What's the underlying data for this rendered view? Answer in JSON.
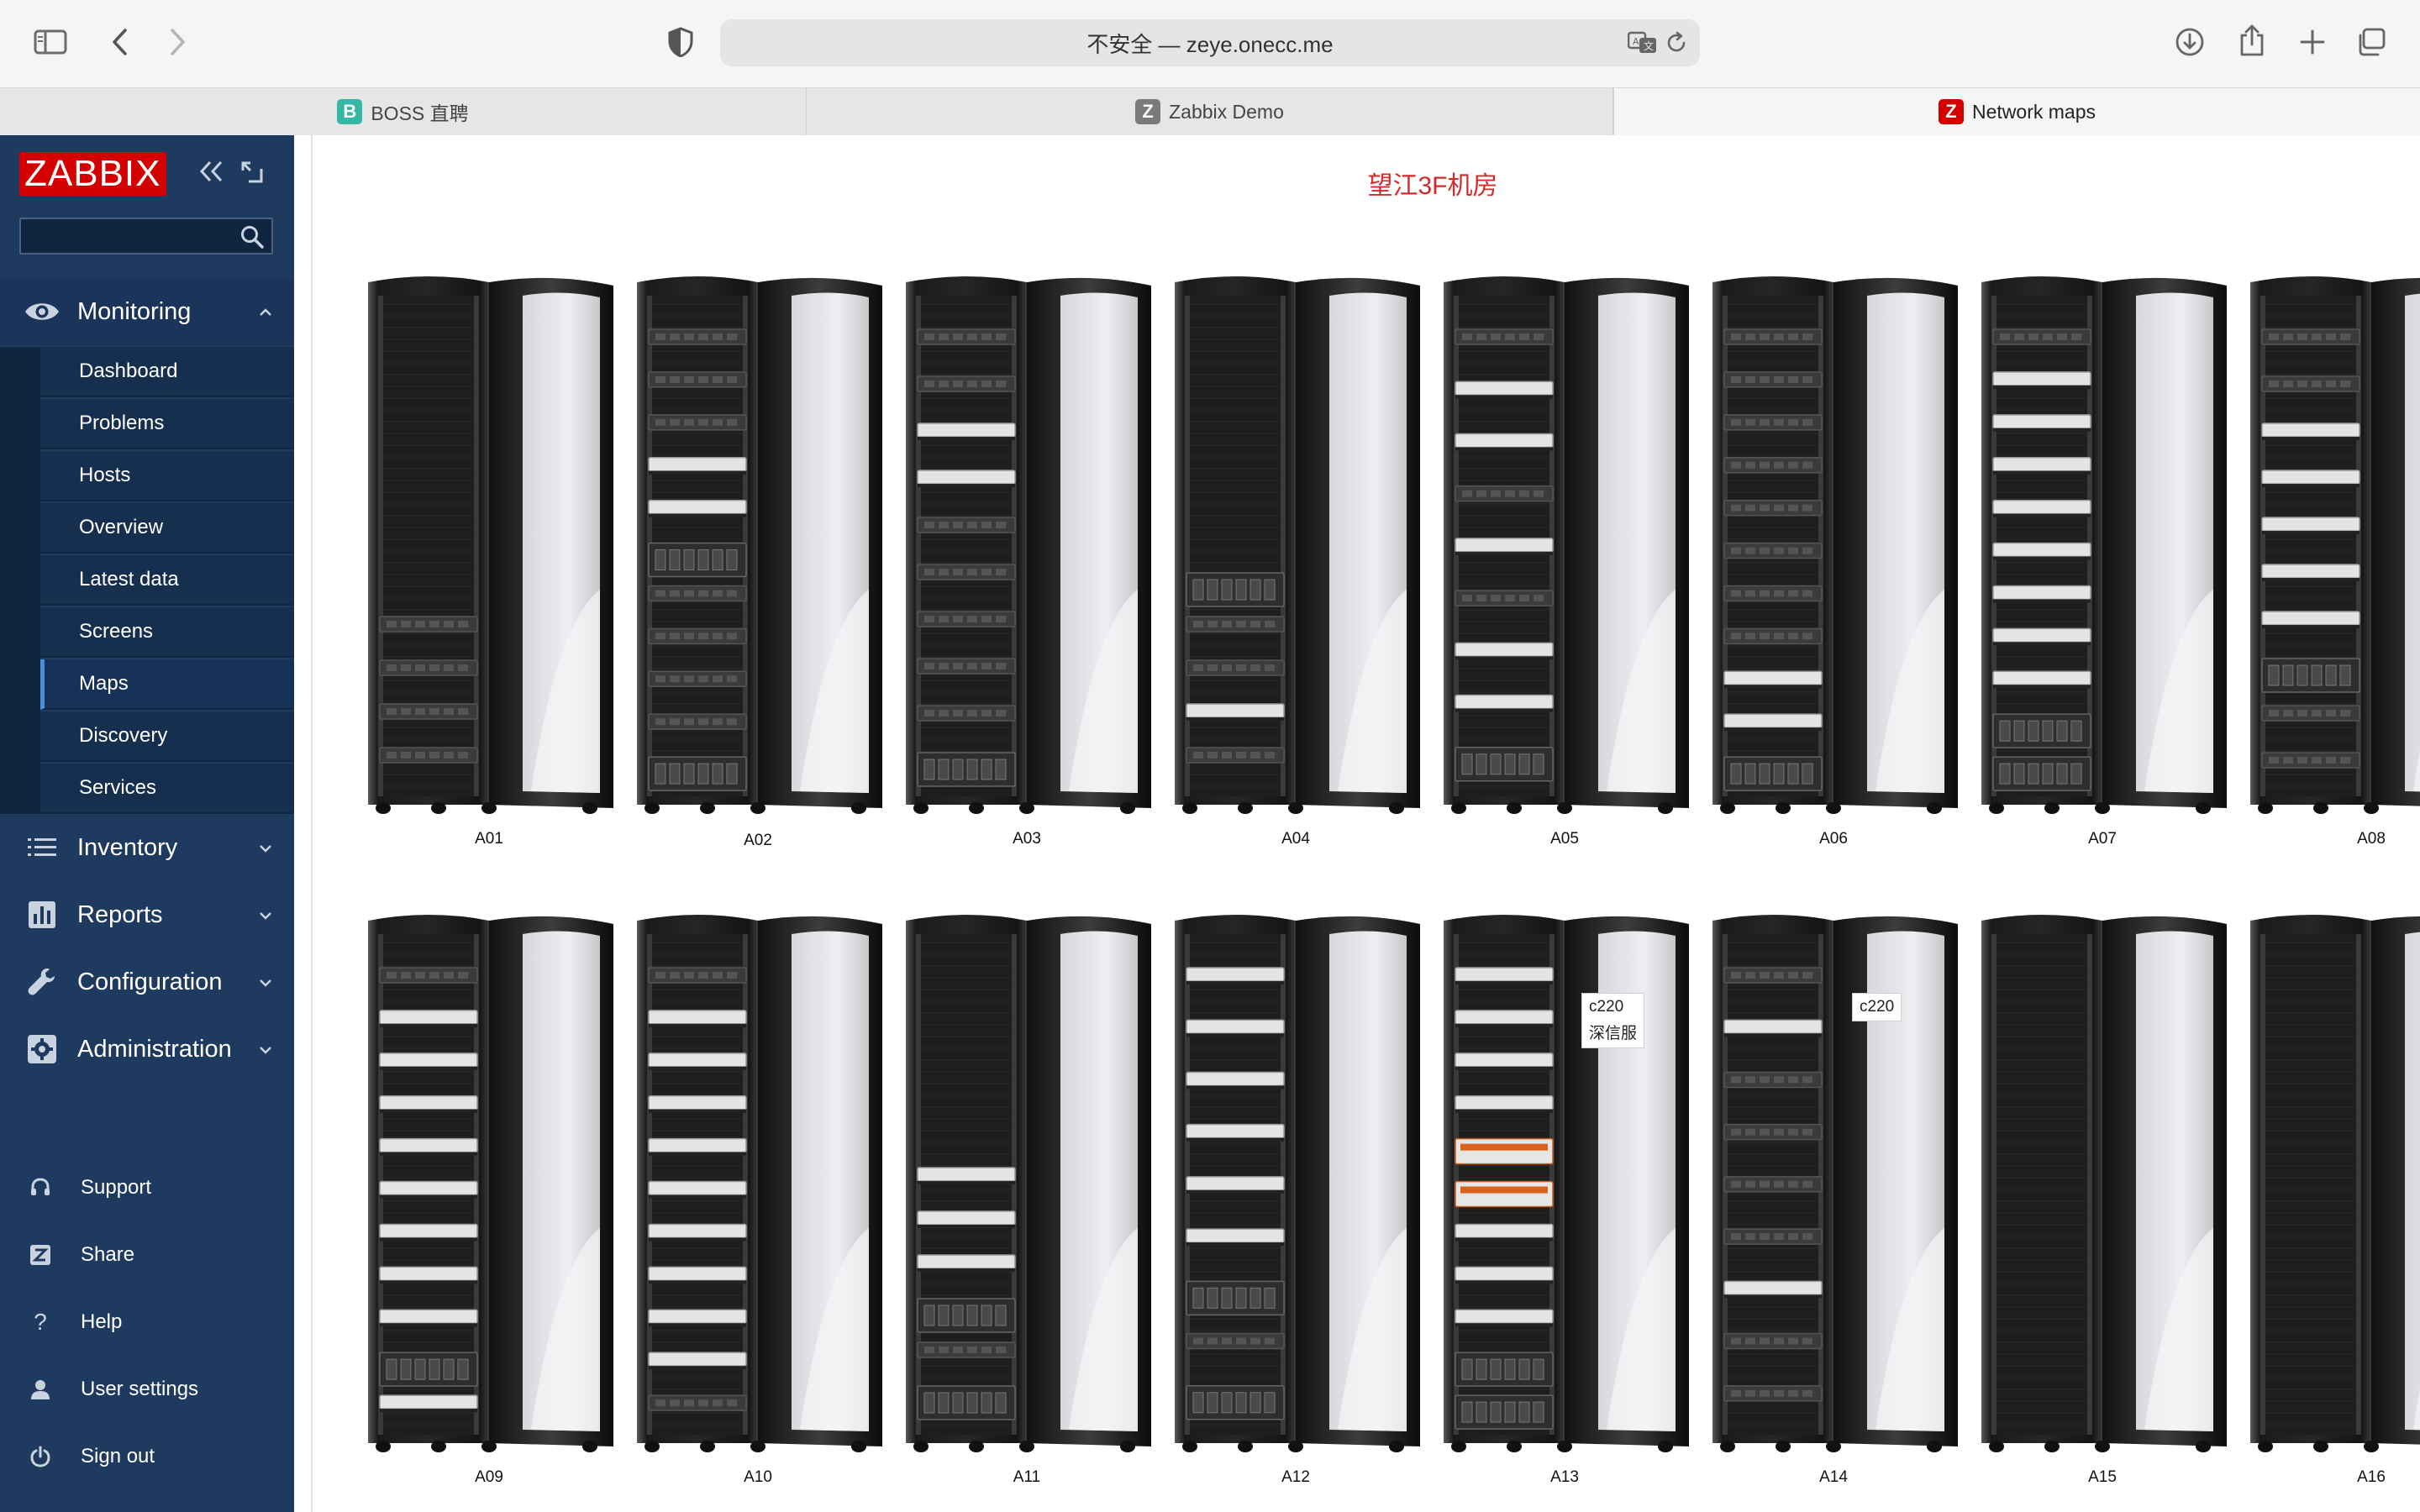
{
  "browser": {
    "address_text": "不安全 — zeye.onecc.me",
    "tabs": [
      {
        "label": "BOSS 直聘",
        "favicon_letter": "B",
        "favicon_color": "#35b8a6"
      },
      {
        "label": "Zabbix Demo",
        "favicon_letter": "Z",
        "favicon_color": "#7a7a7a"
      },
      {
        "label": "Network maps",
        "favicon_letter": "Z",
        "favicon_color": "#d40000"
      }
    ],
    "icons": [
      "sidebar-icon",
      "back-icon",
      "forward-icon",
      "shield-icon",
      "translate-icon",
      "reload-icon",
      "download-icon",
      "share-icon",
      "new-tab-icon",
      "tab-overview-icon"
    ]
  },
  "sidebar": {
    "logo": "ZABBIX",
    "search_placeholder": "",
    "sections": [
      {
        "label": "Monitoring",
        "icon": "eye-icon",
        "expanded": true
      },
      {
        "label": "Inventory",
        "icon": "list-icon",
        "expanded": false
      },
      {
        "label": "Reports",
        "icon": "chart-icon",
        "expanded": false
      },
      {
        "label": "Configuration",
        "icon": "wrench-icon",
        "expanded": false
      },
      {
        "label": "Administration",
        "icon": "gear-icon",
        "expanded": false
      }
    ],
    "monitoring_items": [
      "Dashboard",
      "Problems",
      "Hosts",
      "Overview",
      "Latest data",
      "Screens",
      "Maps",
      "Discovery",
      "Services"
    ],
    "selected_item": "Maps",
    "bottom_items": [
      {
        "label": "Support",
        "icon": "headset-icon"
      },
      {
        "label": "Share",
        "icon": "share-z-icon"
      },
      {
        "label": "Help",
        "icon": "question-icon"
      },
      {
        "label": "User settings",
        "icon": "user-icon"
      },
      {
        "label": "Sign out",
        "icon": "power-icon"
      }
    ]
  },
  "map": {
    "title": "望江3F机房",
    "title_color": "#d42a2a",
    "racks": [
      {
        "label": "A01",
        "servers": [
          "d",
          "d",
          "d",
          "d"
        ]
      },
      {
        "label": "A02",
        "servers": [
          "d",
          "d",
          "d",
          "w",
          "w",
          "b",
          "d",
          "d",
          "d",
          "d",
          "b"
        ]
      },
      {
        "label": "A03",
        "servers": [
          "d",
          "d",
          "w",
          "w",
          "d",
          "d",
          "d",
          "d",
          "d",
          "b"
        ]
      },
      {
        "label": "A04",
        "servers": [
          "b",
          "d",
          "d",
          "w",
          "d"
        ]
      },
      {
        "label": "A05",
        "servers": [
          "d",
          "w",
          "w",
          "d",
          "w",
          "d",
          "w",
          "w",
          "b"
        ]
      },
      {
        "label": "A06",
        "servers": [
          "d",
          "d",
          "d",
          "d",
          "d",
          "d",
          "d",
          "d",
          "w",
          "w",
          "b"
        ]
      },
      {
        "label": "A07",
        "servers": [
          "d",
          "w",
          "w",
          "w",
          "w",
          "w",
          "w",
          "w",
          "w",
          "b",
          "b"
        ]
      },
      {
        "label": "A08",
        "servers": [
          "d",
          "d",
          "w",
          "w",
          "w",
          "w",
          "w",
          "b",
          "d",
          "d"
        ]
      },
      {
        "label": "A09",
        "servers": [
          "d",
          "w",
          "w",
          "w",
          "w",
          "w",
          "w",
          "w",
          "w",
          "b",
          "w"
        ]
      },
      {
        "label": "A10",
        "servers": [
          "d",
          "w",
          "w",
          "w",
          "w",
          "w",
          "w",
          "w",
          "w",
          "w",
          "d"
        ]
      },
      {
        "label": "A11",
        "servers": [
          "w",
          "w",
          "w",
          "b",
          "d",
          "b"
        ]
      },
      {
        "label": "A12",
        "servers": [
          "w",
          "w",
          "w",
          "w",
          "w",
          "w",
          "b",
          "d",
          "b"
        ]
      },
      {
        "label": "A13",
        "servers": [
          "w",
          "w",
          "w",
          "w",
          "o",
          "o",
          "w",
          "w",
          "w",
          "b",
          "b"
        ],
        "host_labels": [
          "c220",
          "深信服"
        ]
      },
      {
        "label": "A14",
        "servers": [
          "d",
          "w",
          "d",
          "d",
          "d",
          "d",
          "w",
          "d",
          "d"
        ],
        "host_labels": [
          "c220"
        ]
      },
      {
        "label": "A15",
        "servers": []
      },
      {
        "label": "A16",
        "servers": []
      }
    ]
  }
}
